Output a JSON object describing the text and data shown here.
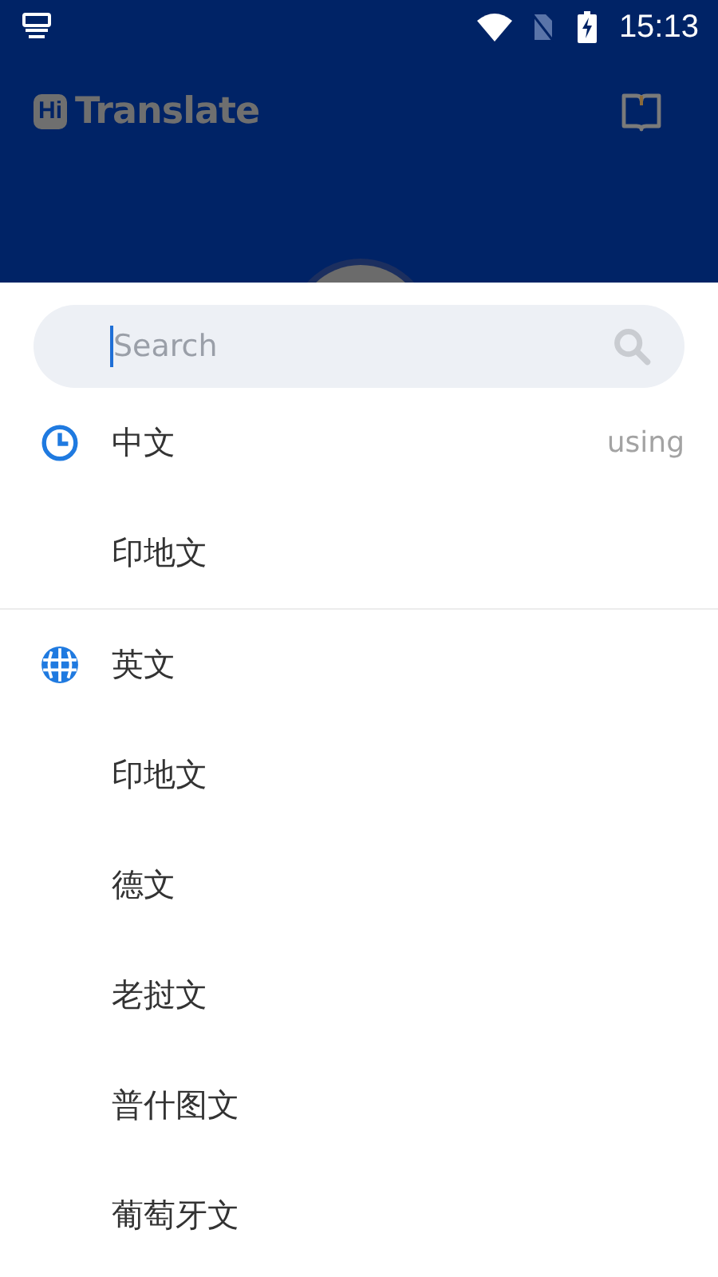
{
  "status_bar": {
    "time": "15:13"
  },
  "header": {
    "logo_badge": "Hi",
    "logo_text": "Translate"
  },
  "search": {
    "placeholder": "Search"
  },
  "sections": [
    {
      "kind": "recent",
      "items": [
        {
          "label": "中文",
          "note": "using"
        },
        {
          "label": "印地文"
        }
      ]
    },
    {
      "kind": "all",
      "items": [
        {
          "label": "英文"
        },
        {
          "label": "印地文"
        },
        {
          "label": "德文"
        },
        {
          "label": "老挝文"
        },
        {
          "label": "普什图文"
        },
        {
          "label": "葡萄牙文"
        }
      ]
    }
  ]
}
